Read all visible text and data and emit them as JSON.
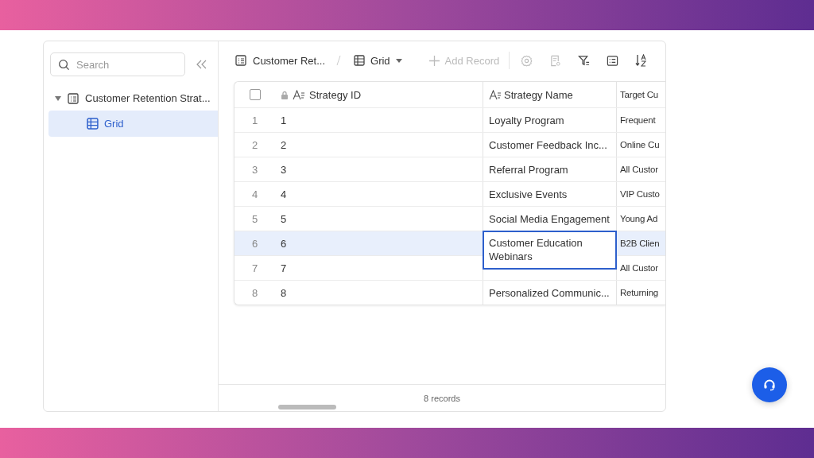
{
  "sidebar": {
    "search": {
      "placeholder": "Search"
    },
    "tree": [
      {
        "label": "Customer Retention Strat...",
        "expanded": true,
        "children": [
          {
            "label": "Grid",
            "selected": true
          }
        ]
      }
    ]
  },
  "toolbar": {
    "breadcrumb": "Customer Ret...",
    "view": "Grid",
    "add_record": "Add Record"
  },
  "table": {
    "select_all": {
      "checked": false
    },
    "columns": [
      {
        "label": "Strategy ID",
        "locked": true
      },
      {
        "label": "Strategy Name",
        "locked": false
      },
      {
        "label": "Target Cu",
        "locked": false
      }
    ],
    "rows": [
      {
        "number": "1",
        "id": "1",
        "name": "Loyalty Program",
        "target": "Frequent",
        "selected": false,
        "editing": false
      },
      {
        "number": "2",
        "id": "2",
        "name": "Customer Feedback Inc...",
        "target": "Online Cu",
        "selected": false,
        "editing": false
      },
      {
        "number": "3",
        "id": "3",
        "name": "Referral Program",
        "target": "All Custor",
        "selected": false,
        "editing": false
      },
      {
        "number": "4",
        "id": "4",
        "name": "Exclusive Events",
        "target": "VIP Custo",
        "selected": false,
        "editing": false
      },
      {
        "number": "5",
        "id": "5",
        "name": "Social Media Engagement",
        "target": "Young Ad",
        "selected": false,
        "editing": false
      },
      {
        "number": "6",
        "id": "6",
        "name": "Customer Education Webinars",
        "target": "B2B Clien",
        "selected": true,
        "editing": true
      },
      {
        "number": "7",
        "id": "7",
        "target": "All Custor",
        "selected": false,
        "editing": false
      },
      {
        "number": "8",
        "id": "8",
        "name": "Personalized Communic...",
        "target": "Returning",
        "selected": false,
        "editing": false
      }
    ]
  },
  "footer": {
    "count": "8 records"
  }
}
